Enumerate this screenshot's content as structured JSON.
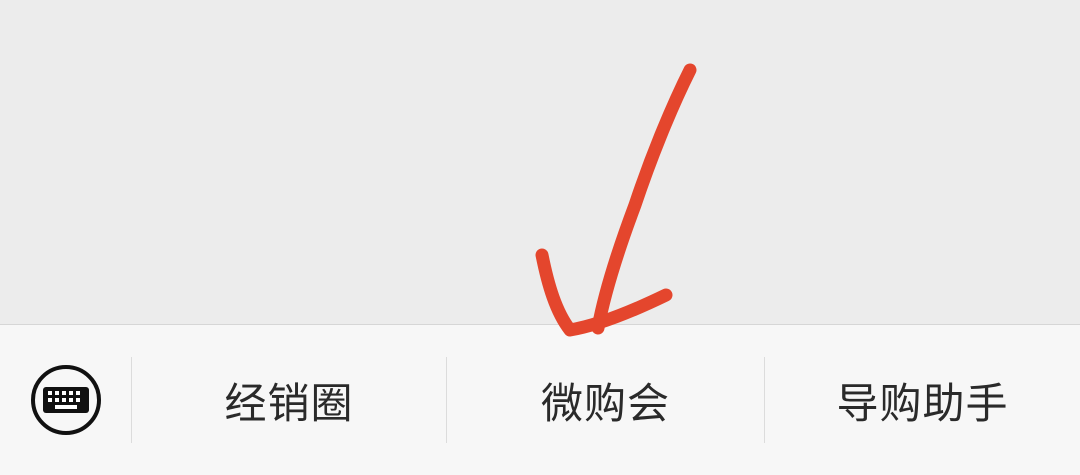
{
  "menu": {
    "keyboard_icon": "keyboard-icon",
    "items": [
      {
        "label": "经销圈"
      },
      {
        "label": "微购会"
      },
      {
        "label": "导购助手"
      }
    ]
  },
  "annotation": {
    "arrow_icon": "arrow-down-icon",
    "color": "#e4462d"
  },
  "colors": {
    "background": "#ececec",
    "menu_bar": "#f7f7f7",
    "text": "#2a2a2a"
  }
}
